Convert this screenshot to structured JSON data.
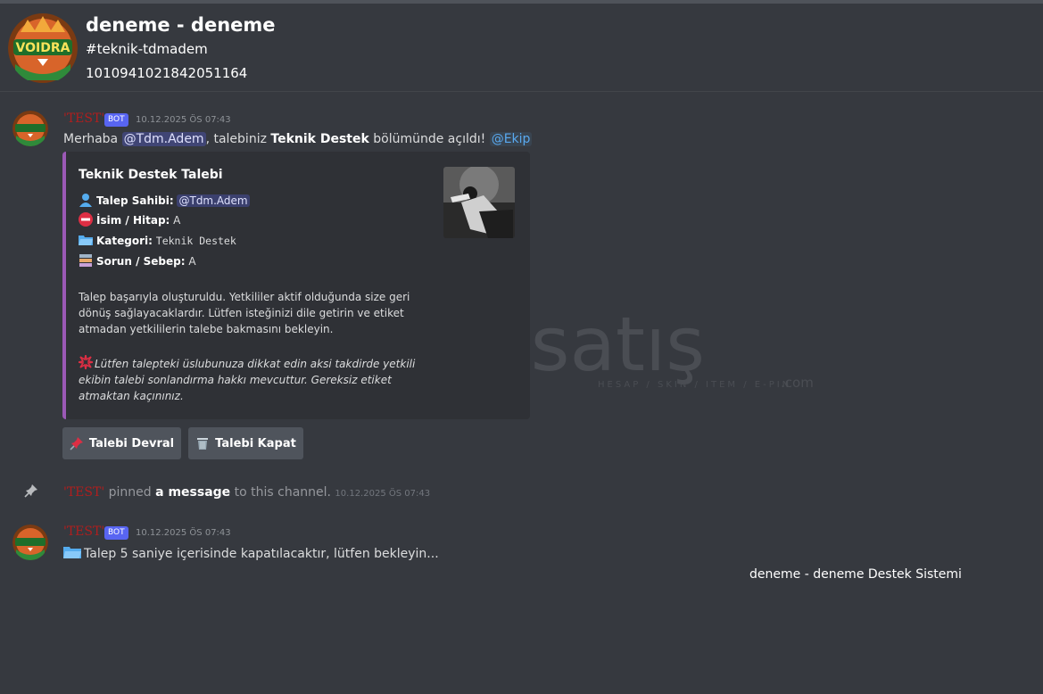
{
  "header": {
    "guild_name": "deneme - deneme",
    "channel_name": "#teknik-tdmadem",
    "channel_id": "1010941021842051164",
    "avatar_text": "VOIDRA"
  },
  "messages": [
    {
      "author": "'TEST'",
      "bot_tag": "BOT",
      "timestamp": "10.12.2025 ÖS 07:43",
      "content": {
        "pre": "Merhaba ",
        "mention_user": "@Tdm.Adem",
        "mid": ", talebiniz ",
        "strong": "Teknik Destek",
        "post": " bölümünde açıldı! ",
        "mention_role": "@Ekip"
      },
      "embed": {
        "title": "Teknik Destek Talebi",
        "accent_color": "#9b59b6",
        "fields": [
          {
            "icon": "bust-in-silhouette-icon",
            "key": "Talep Sahibi:",
            "value": "@Tdm.Adem"
          },
          {
            "icon": "no-entry-icon",
            "key": "İsim / Hitap:",
            "value": "A"
          },
          {
            "icon": "open-folder-icon",
            "key": "Kategori:",
            "value": "Teknik Destek"
          },
          {
            "icon": "books-icon",
            "key": "Sorun / Sebep:",
            "value": "A"
          }
        ],
        "description": "Talep başarıyla oluşturuldu. Yetkililer aktif olduğunda size geri dönüş sağlayacaklardır. Lütfen isteğinizi dile getirin ve etiket atmadan yetkililerin talebe bakmasını bekleyin.",
        "warning_icon": "anger-icon",
        "warning": "Lütfen talepteki üslubunuza dikkat edin aksi takdirde yetkili ekibin talebi sonlandırma hakkı mevcuttur. Gereksiz etiket atmaktan kaçınınız."
      },
      "buttons": [
        {
          "icon": "pushpin-icon",
          "label": "Talebi Devral"
        },
        {
          "icon": "wastebasket-icon",
          "label": "Talebi Kapat"
        }
      ]
    },
    {
      "type": "system",
      "author": "'TEST'",
      "text_pre": " pinned ",
      "text_link": "a message",
      "text_post": " to this channel. ",
      "timestamp": "10.12.2025 ÖS 07:43"
    },
    {
      "author": "'TEST'",
      "bot_tag": "BOT",
      "timestamp": "10.12.2025 ÖS 07:43",
      "content": "Talep 5 saniye içerisinde kapatılacaktır, lütfen bekleyin..."
    }
  ],
  "footer": {
    "text": "deneme - deneme Destek Sistemi"
  },
  "watermark": {
    "brand": "itemsatış",
    "tagline": "HESAP / SKIN / ITEM / E-PIN",
    "suffix": ".com"
  }
}
